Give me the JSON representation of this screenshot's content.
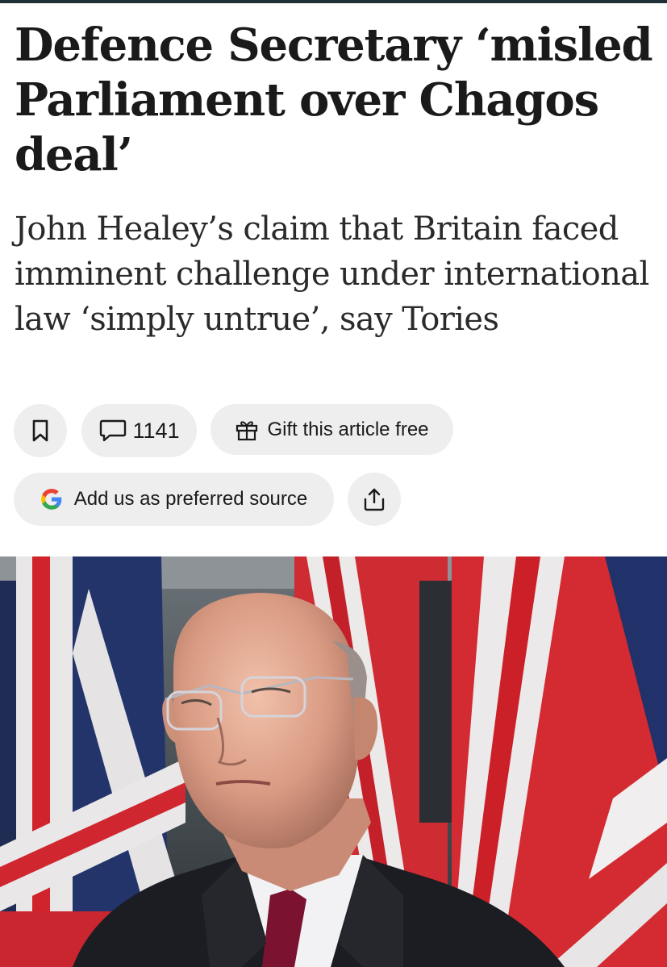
{
  "article": {
    "headline": "Defence Secretary ‘misled Parliament over Chagos deal’",
    "standfirst": "John Healey’s claim that Britain faced imminent challenge under international law ‘simply untrue’, say Tories"
  },
  "actions": {
    "comment_count": "1141",
    "gift_label": "Gift this article free",
    "preferred_source_label": "Add us as preferred source"
  },
  "icons": {
    "bookmark": "bookmark-icon",
    "comments": "speech-bubble-icon",
    "gift": "gift-icon",
    "google": "google-g-icon",
    "share": "share-icon"
  },
  "colors": {
    "headline": "#1a1a1a",
    "pill_background": "#eeeeee",
    "google_blue": "#4285F4",
    "google_red": "#EA4335",
    "google_yellow": "#FBBC05",
    "google_green": "#34A853"
  }
}
